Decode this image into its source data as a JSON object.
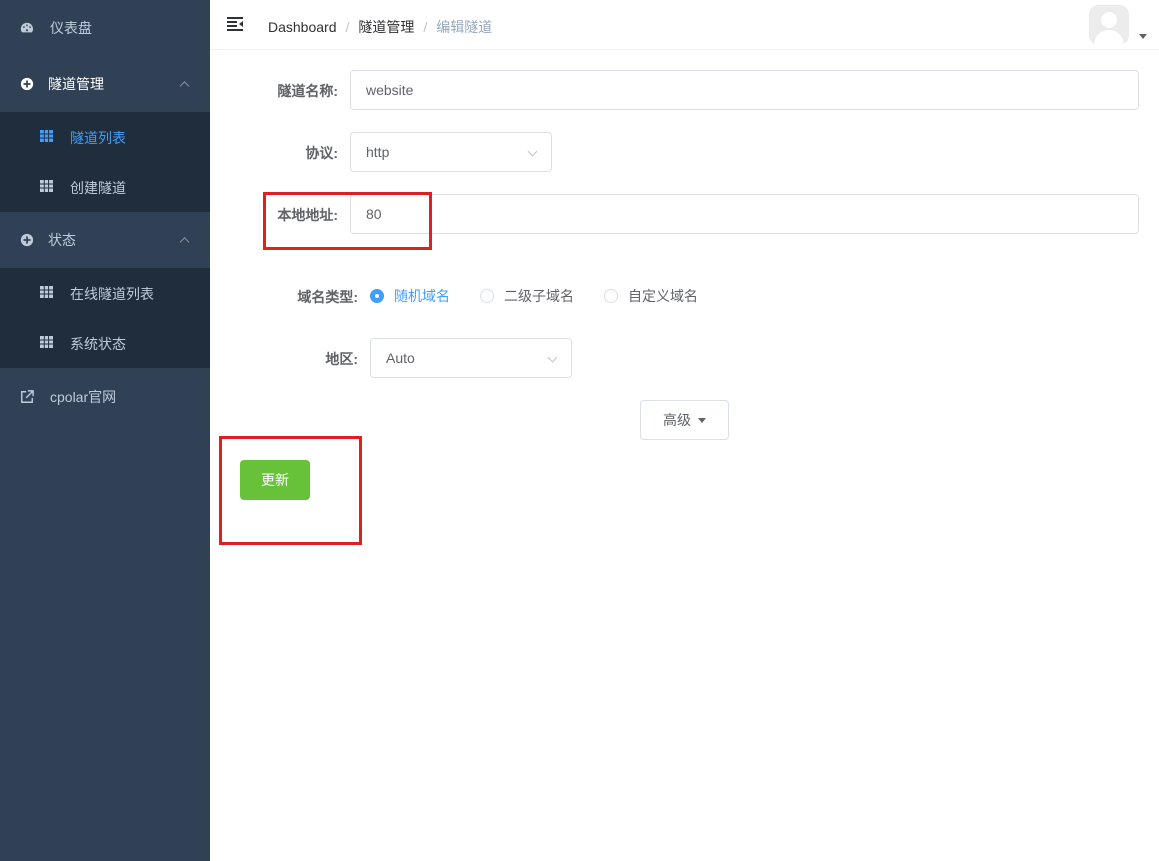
{
  "sidebar": {
    "items": [
      {
        "label": "仪表盘",
        "icon": "dashboard-icon"
      },
      {
        "label": "隧道管理",
        "icon": "tunnel-circle-icon",
        "expanded": true,
        "children": [
          {
            "label": "隧道列表",
            "icon": "grid-icon",
            "active": true
          },
          {
            "label": "创建隧道",
            "icon": "grid-icon"
          }
        ]
      },
      {
        "label": "状态",
        "icon": "status-circle-icon",
        "expanded": true,
        "children": [
          {
            "label": "在线隧道列表",
            "icon": "grid-icon"
          },
          {
            "label": "系统状态",
            "icon": "grid-icon"
          }
        ]
      },
      {
        "label": "cpolar官网",
        "icon": "external-link-icon"
      }
    ]
  },
  "header": {
    "breadcrumb": [
      "Dashboard",
      "隧道管理",
      "编辑隧道"
    ],
    "separator": "/"
  },
  "form": {
    "name": {
      "label": "隧道名称:",
      "value": "website"
    },
    "protocol": {
      "label": "协议:",
      "value": "http"
    },
    "local_addr": {
      "label": "本地地址:",
      "value": "80"
    },
    "domain_type": {
      "label": "域名类型:",
      "options": [
        "随机域名",
        "二级子域名",
        "自定义域名"
      ],
      "selected": "随机域名"
    },
    "region": {
      "label": "地区:",
      "value": "Auto"
    },
    "advanced_label": "高级",
    "update_label": "更新"
  },
  "colors": {
    "sidebar_bg": "#304156",
    "submenu_bg": "#1f2d3d",
    "active": "#409eff",
    "success": "#67c23a",
    "highlight_box": "#e02020"
  }
}
